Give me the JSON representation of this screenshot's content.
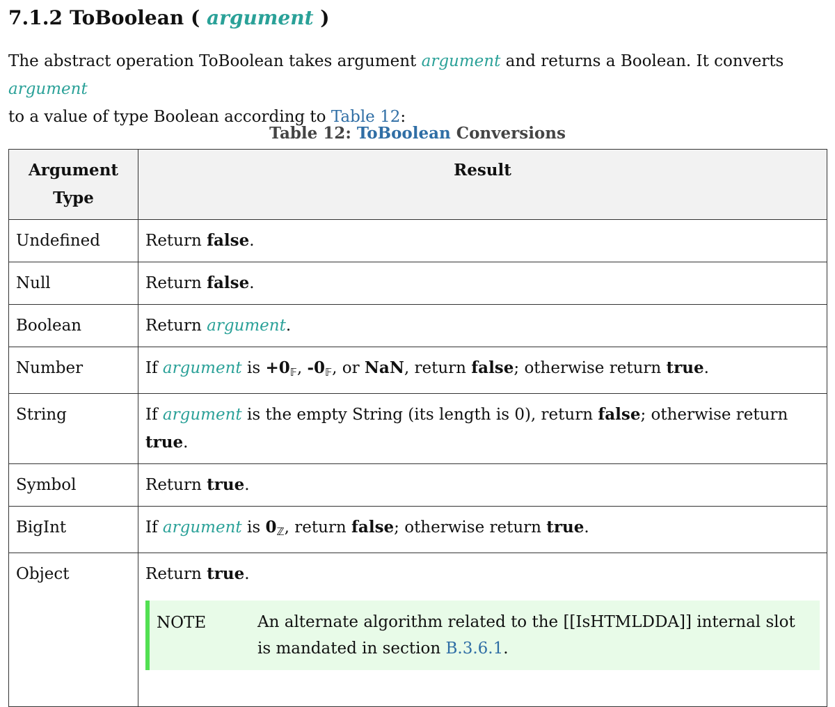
{
  "clause": {
    "number": "7.1.2",
    "name": "ToBoolean (",
    "param": "argument",
    "close": ")"
  },
  "intro": {
    "part1": "The abstract operation ToBoolean takes argument ",
    "param1": "argument",
    "part2": " and returns a Boolean. It converts ",
    "param2": "argument",
    "part3": " to a value of type Boolean according to ",
    "table_link": "Table 12",
    "part4": ":"
  },
  "caption": {
    "prefix": "Table 12: ",
    "link": "ToBoolean",
    "suffix": " Conversions"
  },
  "table": {
    "headers": {
      "type": "Argument Type",
      "result": "Result"
    },
    "rows": [
      {
        "type": "Undefined",
        "text": [
          "Return ",
          "false",
          "."
        ]
      },
      {
        "type": "Null",
        "text": [
          "Return ",
          "false",
          "."
        ]
      },
      {
        "type": "Boolean",
        "text": [
          "Return ",
          "argument",
          "."
        ]
      },
      {
        "type": "Number",
        "text": [
          "If ",
          "argument",
          " is ",
          "+0",
          "𝔽",
          ", ",
          "-0",
          "𝔽",
          ", or ",
          "NaN",
          ", return ",
          "false",
          "; otherwise return ",
          "true",
          "."
        ]
      },
      {
        "type": "String",
        "text": [
          "If ",
          "argument",
          " is the empty String (its length is 0), return ",
          "false",
          "; otherwise return ",
          "true",
          "."
        ]
      },
      {
        "type": "Symbol",
        "text": [
          "Return ",
          "true",
          "."
        ]
      },
      {
        "type": "BigInt",
        "text": [
          "If ",
          "argument",
          " is ",
          "0",
          "ℤ",
          ", return ",
          "false",
          "; otherwise return ",
          "true",
          "."
        ]
      },
      {
        "type": "Object",
        "text": [
          "Return ",
          "true",
          "."
        ]
      }
    ],
    "note": {
      "label": "NOTE",
      "text": "An alternate algorithm related to the [[IsHTMLDDA]] internal slot is mandated in section ",
      "link": "B.3.6.1",
      "end": "."
    }
  }
}
